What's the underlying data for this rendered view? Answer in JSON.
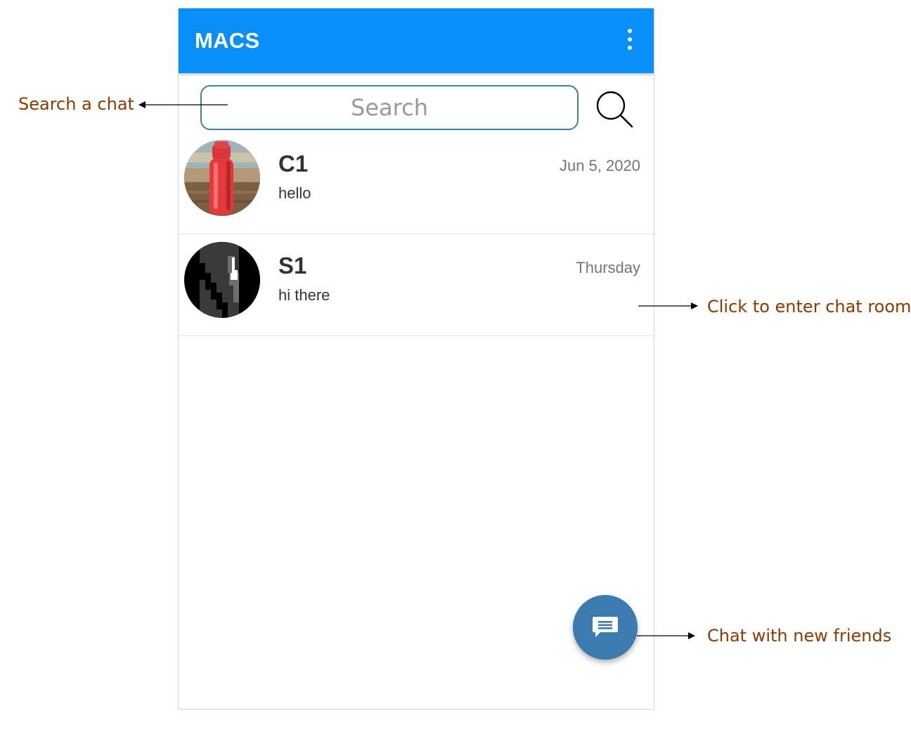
{
  "appbar": {
    "title": "MACS",
    "color": "#0a8ff8",
    "menu_icon": "more-vert-icon"
  },
  "search": {
    "placeholder": "Search",
    "icon": "search-icon"
  },
  "chats": [
    {
      "name": "C1",
      "preview": "hello",
      "time": "Jun 5, 2020",
      "avatar_icon": "red-bottle-photo"
    },
    {
      "name": "S1",
      "preview": "hi there",
      "time": "Thursday",
      "avatar_icon": "black-pixel-photo"
    }
  ],
  "fab": {
    "icon": "chat-bubble-icon",
    "color": "#3b7bb0"
  },
  "annotations": {
    "search": "Search a chat",
    "chat_item": "Click to enter chat room",
    "fab": "Chat with new friends",
    "color": "#8b3a00"
  }
}
